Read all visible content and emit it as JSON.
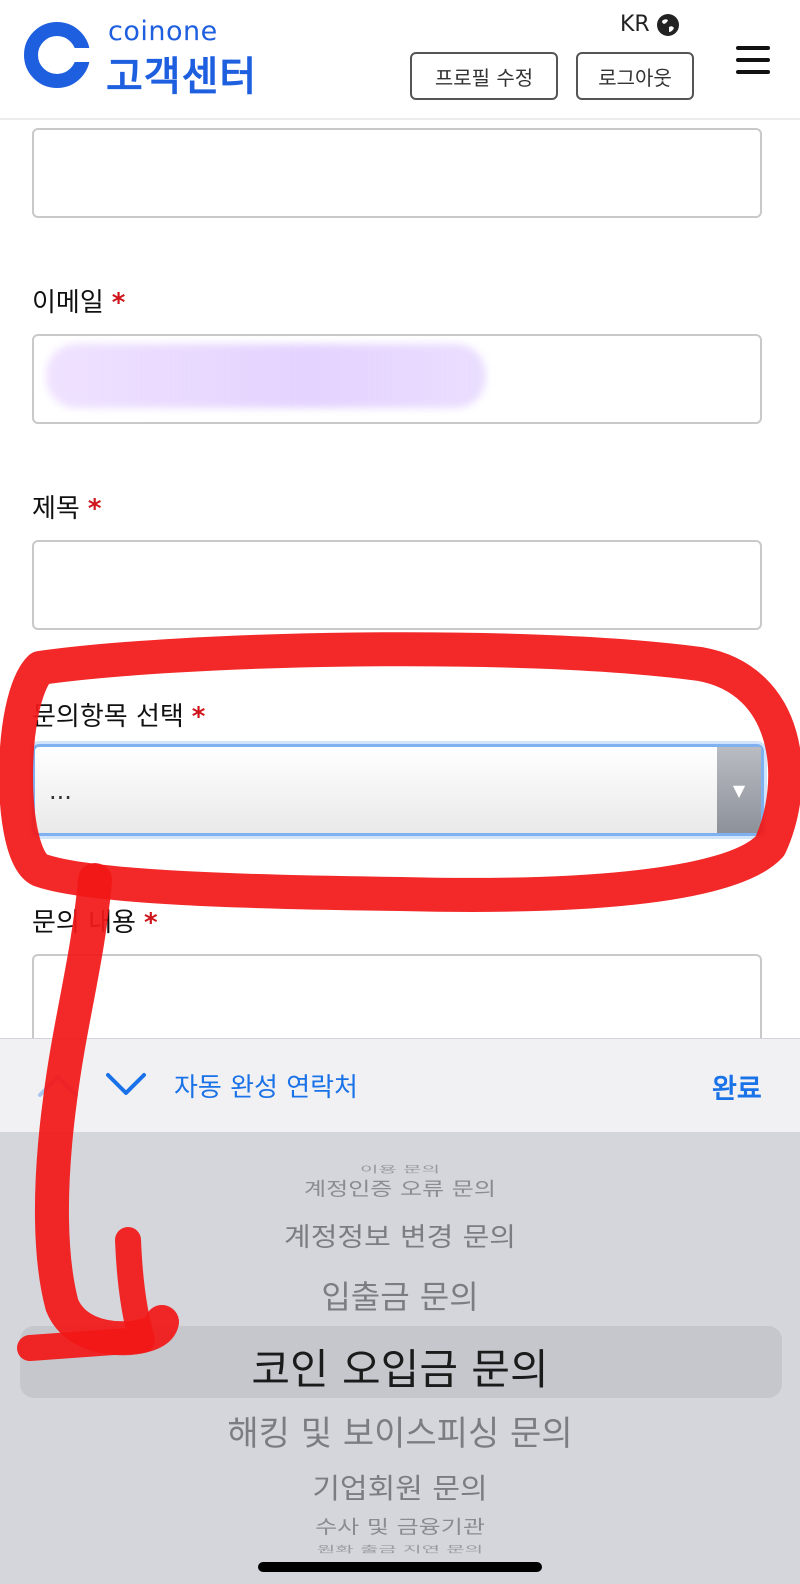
{
  "header": {
    "brand_name": "coinone",
    "brand_sub": "고객센터",
    "language": "KR",
    "profile_button": "프로필 수정",
    "logout_button": "로그아웃"
  },
  "form": {
    "email_label": "이메일",
    "subject_label": "제목",
    "category_label": "문의항목 선택",
    "category_value": "...",
    "content_label": "문의 내용",
    "required_mark": "*"
  },
  "keyboard_bar": {
    "autofill": "자동 완성 연락처",
    "done": "완료"
  },
  "picker": {
    "items": [
      "이용 문의",
      "계정인증 오류 문의",
      "계정정보 변경 문의",
      "입출금 문의",
      "코인 오입금 문의",
      "해킹 및 보이스피싱 문의",
      "기업회원 문의",
      "수사 및 금융기관",
      "원화 출금 지연 문의"
    ],
    "selected": "코인 오입금 문의"
  },
  "colors": {
    "brand": "#1e5fe0",
    "accent": "#1a72e8",
    "required": "#d0141b",
    "annotation": "#f21818"
  }
}
